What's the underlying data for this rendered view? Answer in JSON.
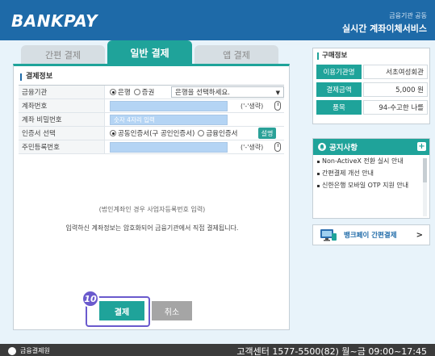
{
  "header": {
    "logo": "BANKPAY",
    "subtitle": "금융기관 공동",
    "title": "실시간 계좌이체서비스"
  },
  "tabs": [
    {
      "label": "간편 결제",
      "active": false
    },
    {
      "label": "일반 결제",
      "active": true
    },
    {
      "label": "앱 결제",
      "active": false
    }
  ],
  "form": {
    "section_title": "결제정보",
    "rows": {
      "bank": {
        "label": "금융기관",
        "radio_bank": "은행",
        "radio_securities": "증권",
        "select_value": "은행을 선택하세요."
      },
      "account": {
        "label": "계좌번호",
        "value": "",
        "omit_hint": "('-'생략)"
      },
      "password": {
        "label": "계좌 비밀번호",
        "placeholder": "숫자 4자리 입력"
      },
      "cert": {
        "label": "인증서 선택",
        "option1": "공동인증서(구 공인인증서)",
        "option2": "금융인증서",
        "help_button": "설명"
      },
      "resident": {
        "label": "주민등록번호",
        "value": "",
        "omit_hint": "('-'생략)"
      }
    },
    "corp_note": "(법인계좌인 경우 사업자등록번호 입력)",
    "encrypt_note": "입력하신 계좌정보는 암호화되어 금융기관에서 직접 결제됩니다."
  },
  "actions": {
    "pay_label": "결제",
    "cancel_label": "취소",
    "step_badge": "10"
  },
  "purchase": {
    "title": "구매정보",
    "rows": [
      {
        "label": "이용기관명",
        "value": "서초여성회관"
      },
      {
        "label": "결제금액",
        "value": "5,000 원"
      },
      {
        "label": "품목",
        "value": "94-수고한 나를"
      }
    ]
  },
  "notice": {
    "title": "공지사항",
    "plus": "+",
    "items": [
      "Non-ActiveX 전환 실시 안내",
      "간편결제 개선 안내",
      "신한은행 모바일 OTP 지원 안내"
    ]
  },
  "banner": {
    "label": "뱅크페이 간편결제",
    "arrow": ">"
  },
  "footer": {
    "org": "금융결제원",
    "contact": "고객센터 1577-5500(82)    월~금 09:00~17:45"
  },
  "colors": {
    "header": "#1e6aa8",
    "accent": "#1fa39a",
    "highlight": "#6a5acd"
  }
}
